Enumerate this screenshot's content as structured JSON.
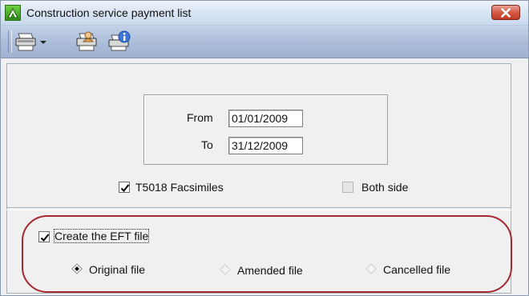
{
  "window": {
    "title": "Construction service payment list"
  },
  "toolbar": {
    "buttons": [
      {
        "name": "print",
        "icon": "printer-dropdown-icon"
      },
      {
        "name": "print-preview",
        "icon": "printer-person-icon"
      },
      {
        "name": "printer-info",
        "icon": "printer-info-icon"
      }
    ]
  },
  "dates": {
    "from_label": "From",
    "from_value": "01/01/2009",
    "to_label": "To",
    "to_value": "31/12/2009"
  },
  "options": {
    "facsimiles_label": "T5018 Facsimiles",
    "facsimiles_checked": true,
    "both_side_label": "Both side",
    "both_side_checked": false,
    "both_side_enabled": false
  },
  "eft": {
    "create_label": "Create the EFT file",
    "create_checked": true,
    "file_types": [
      {
        "label": "Original file",
        "selected": true
      },
      {
        "label": "Amended file",
        "selected": false
      },
      {
        "label": "Cancelled file",
        "selected": false
      }
    ]
  },
  "colors": {
    "annotation": "#a4282f",
    "toolbar": "#a9bbd8",
    "close_button": "#d45a45"
  }
}
